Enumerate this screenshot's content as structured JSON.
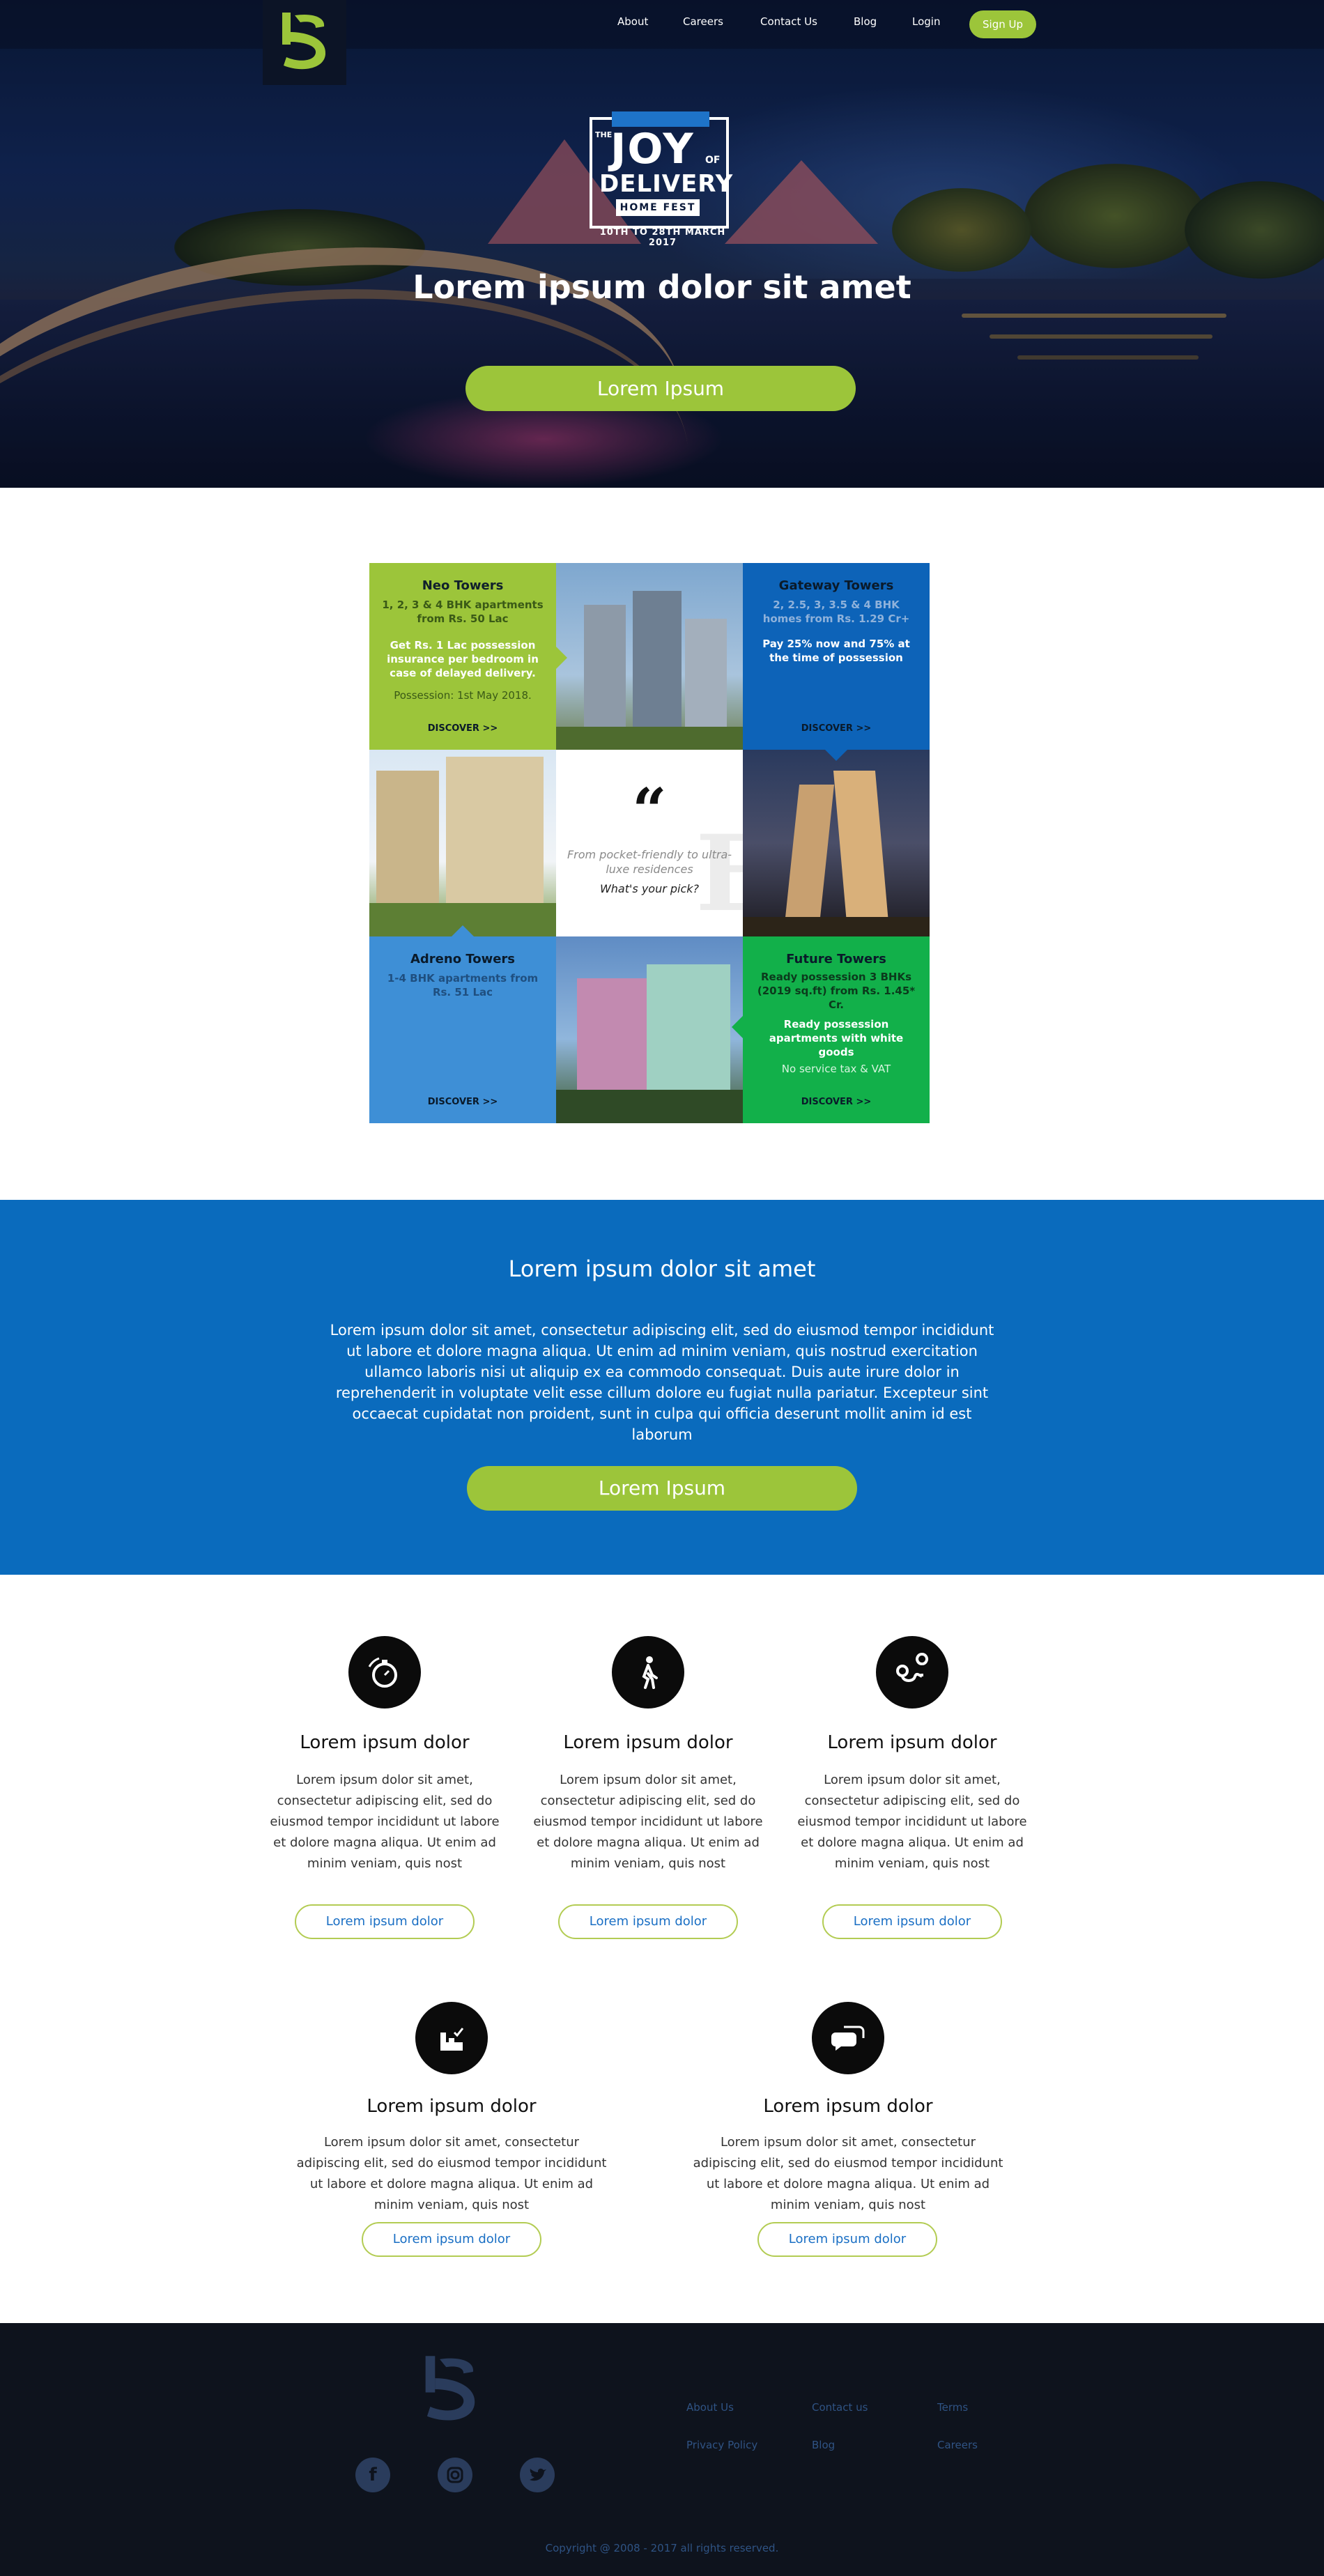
{
  "nav": {
    "items": [
      "About",
      "Careers",
      "Contact Us",
      "Blog",
      "Login"
    ],
    "signup_label": "Sign Up"
  },
  "hero": {
    "badge": {
      "the": "THE",
      "joy": "JOY",
      "of": "OF",
      "delivery": "DELIVERY",
      "fest": "HOME FEST",
      "dates": "10TH TO 28TH MARCH 2017"
    },
    "title": "Lorem ipsum dolor sit amet",
    "cta_label": "Lorem Ipsum"
  },
  "grid": {
    "neo": {
      "title": "Neo Towers",
      "desc": "1, 2, 3 & 4 BHK apartments from Rs. 50 Lac",
      "offer": "Get Rs. 1 Lac possession insurance per bedroom in case of delayed delivery.",
      "possession": "Possession: 1st May 2018.",
      "discover": "DISCOVER >>"
    },
    "gateway": {
      "title": "Gateway Towers",
      "desc": "2, 2.5, 3, 3.5 & 4 BHK homes from Rs. 1.29 Cr+",
      "offer": "Pay 25% now and 75% at the time of possession",
      "discover": "DISCOVER >>"
    },
    "quote": {
      "mark": "“",
      "text": "From pocket-friendly to ultra-luxe residences",
      "pick": "What's your pick?"
    },
    "adreno": {
      "title": "Adreno Towers",
      "desc": "1-4 BHK apartments from Rs. 51 Lac",
      "discover": "DISCOVER >>"
    },
    "future": {
      "title": "Future Towers",
      "desc": "Ready possession 3 BHKs (2019 sq.ft) from Rs. 1.45* Cr.",
      "offer": "Ready possession apartments with white goods",
      "tax": "No service tax & VAT",
      "discover": "DISCOVER >>"
    }
  },
  "blue_section": {
    "title": "Lorem ipsum dolor sit amet",
    "body": "Lorem ipsum dolor sit amet, consectetur adipiscing elit, sed do eiusmod tempor incididunt ut labore et dolore magna aliqua. Ut enim ad minim veniam, quis nostrud exercitation ullamco laboris nisi ut aliquip ex ea commodo consequat. Duis aute irure dolor in reprehenderit in voluptate velit esse cillum dolore eu fugiat nulla pariatur. Excepteur sint occaecat cupidatat non proident, sunt in culpa qui officia deserunt mollit anim id est laborum",
    "cta_label": "Lorem Ipsum"
  },
  "features": [
    {
      "icon": "stopwatch-icon",
      "title": "Lorem ipsum dolor",
      "body": "Lorem ipsum dolor sit amet, consectetur adipiscing elit, sed do eiusmod tempor incididunt ut labore et dolore magna aliqua. Ut enim ad minim veniam, quis nost",
      "button": "Lorem ipsum dolor"
    },
    {
      "icon": "walking-person-icon",
      "title": "Lorem ipsum dolor",
      "body": "Lorem ipsum dolor sit amet, consectetur adipiscing elit, sed do eiusmod tempor incididunt ut labore et dolore magna aliqua. Ut enim ad minim veniam, quis nost",
      "button": "Lorem ipsum dolor"
    },
    {
      "icon": "route-pin-icon",
      "title": "Lorem ipsum dolor",
      "body": "Lorem ipsum dolor sit amet, consectetur adipiscing elit, sed do eiusmod tempor incididunt ut labore et dolore magna aliqua. Ut enim ad minim veniam, quis nost",
      "button": "Lorem ipsum dolor"
    },
    {
      "icon": "factory-check-icon",
      "title": "Lorem ipsum dolor",
      "body": "Lorem ipsum dolor sit amet, consectetur adipiscing elit, sed do eiusmod tempor incididunt ut labore et dolore magna aliqua. Ut enim ad minim veniam, quis nost",
      "button": "Lorem ipsum dolor"
    },
    {
      "icon": "chat-bubbles-icon",
      "title": "Lorem ipsum dolor",
      "body": "Lorem ipsum dolor sit amet, consectetur adipiscing elit, sed do eiusmod tempor incididunt ut labore et dolore magna aliqua. Ut enim ad minim veniam, quis nost",
      "button": "Lorem ipsum dolor"
    }
  ],
  "footer": {
    "social": [
      "facebook-icon",
      "instagram-icon",
      "twitter-icon"
    ],
    "links": [
      "About Us",
      "Contact us",
      "Terms",
      "Privacy Policy",
      "Blog",
      "Careers"
    ],
    "copyright": "Copyright @ 2008 - 2017 all rights reserved."
  },
  "colors": {
    "accent_green": "#9cc53a",
    "brand_blue": "#0a6bbd",
    "footer_bg": "#0e131d",
    "footer_text": "#2f5384"
  }
}
